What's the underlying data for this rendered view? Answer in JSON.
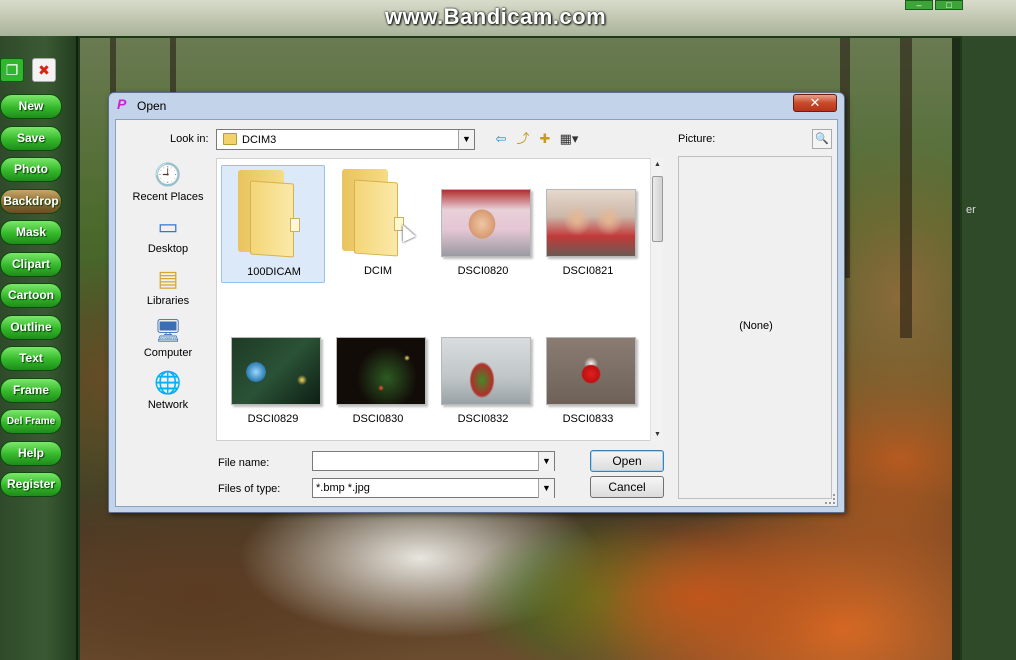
{
  "watermark": "www.Bandicam.com",
  "toolbar": {
    "buttons": [
      {
        "label": "New"
      },
      {
        "label": "Save"
      },
      {
        "label": "Photo"
      },
      {
        "label": "Backdrop"
      },
      {
        "label": "Mask"
      },
      {
        "label": "Clipart"
      },
      {
        "label": "Cartoon"
      },
      {
        "label": "Outline"
      },
      {
        "label": "Text"
      },
      {
        "label": "Frame"
      },
      {
        "label": "Del Frame"
      },
      {
        "label": "Help"
      },
      {
        "label": "Register"
      }
    ]
  },
  "right_strip_text": "er",
  "dialog": {
    "title": "Open",
    "close_label": "✕",
    "look_in_label": "Look in:",
    "look_in_value": "DCIM3",
    "places": [
      {
        "label": "Recent Places",
        "icon": "recent-places-icon"
      },
      {
        "label": "Desktop",
        "icon": "desktop-icon"
      },
      {
        "label": "Libraries",
        "icon": "libraries-icon"
      },
      {
        "label": "Computer",
        "icon": "computer-icon"
      },
      {
        "label": "Network",
        "icon": "network-icon"
      }
    ],
    "files": [
      {
        "name": "100DICAM",
        "kind": "folder",
        "selected": true
      },
      {
        "name": "DCIM",
        "kind": "folder",
        "selected": false
      },
      {
        "name": "DSCI0820",
        "kind": "image",
        "selected": false
      },
      {
        "name": "DSCI0821",
        "kind": "image",
        "selected": false
      },
      {
        "name": "DSCI0829",
        "kind": "image",
        "selected": false
      },
      {
        "name": "DSCI0830",
        "kind": "image",
        "selected": false
      },
      {
        "name": "DSCI0832",
        "kind": "image",
        "selected": false
      },
      {
        "name": "DSCI0833",
        "kind": "image",
        "selected": false
      }
    ],
    "file_name_label": "File name:",
    "file_name_value": "",
    "files_of_type_label": "Files of type:",
    "files_of_type_value": "*.bmp *.jpg",
    "open_label": "Open",
    "cancel_label": "Cancel",
    "preview_label": "Picture:",
    "preview_value": "(None)"
  }
}
